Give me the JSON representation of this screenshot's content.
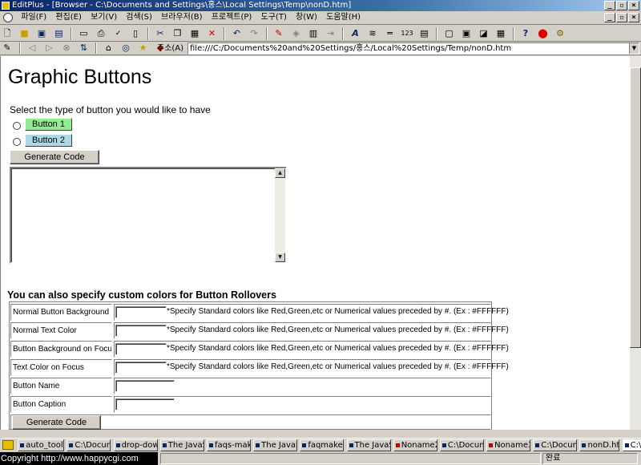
{
  "window": {
    "title": "EditPlus - [Browser - C:\\Documents and Settings\\홍스\\Local Settings\\Temp\\nonD.htm]"
  },
  "menu": {
    "items": [
      "파일(F)",
      "편집(E)",
      "보기(V)",
      "검색(S)",
      "브라우저(B)",
      "프로젝트(P)",
      "도구(T)",
      "창(W)",
      "도움말(H)"
    ]
  },
  "toolbar": {
    "buttons": [
      "new-file-icon",
      "open-folder-icon",
      "save-icon",
      "save-all-icon",
      "print-preview-icon",
      "print-icon",
      "spell-check-icon",
      "page-icon",
      "cut-icon",
      "copy-icon",
      "paste-icon",
      "delete-icon",
      "undo-icon",
      "redo-icon",
      "find-icon",
      "find-next-icon",
      "replace-icon",
      "goto-icon",
      "font-icon",
      "wordwrap-icon",
      "ruler-icon",
      "line-number-icon",
      "cliptext-icon",
      "window-icon",
      "tile-icon",
      "cascade-icon",
      "fullscreen-icon",
      "help-icon",
      "close-red-icon",
      "tools-icon"
    ]
  },
  "address": {
    "label": "주소(A)",
    "value": "file:///C:/Documents%20and%20Settings/홍스/Local%20Settings/Temp/nonD.htm"
  },
  "page": {
    "title": "Graphic Buttons",
    "instruction": "Select the type of button you would like to have",
    "button1_label": "Button 1",
    "button2_label": "Button 2",
    "generate_label": "Generate Code",
    "rollover_heading": "You can also specify custom colors for Button Rollovers",
    "hint": "*Specify Standard colors like Red,Green,etc or Numerical values preceded by #. (Ex : #FFFFFF)",
    "rows": [
      {
        "label": "Normal Button Background"
      },
      {
        "label": "Normal Text Color"
      },
      {
        "label": "Button Background on Focus"
      },
      {
        "label": "Text Color on Focus"
      },
      {
        "label": "Button Name"
      },
      {
        "label": "Button Caption"
      }
    ],
    "generate2_label": "Generate Code",
    "colors": {
      "button1": "#90ee90",
      "button2": "#add8e6"
    }
  },
  "taskbar": {
    "tabs": [
      "auto_tooltip",
      "C:\\Documents",
      "drop-down",
      "The JavaScript",
      "faqs-maker",
      "The JavaScript",
      "faqmaker.",
      "The JavaScript",
      "Noname2",
      "C:\\Documents",
      "Noname3",
      "C:\\Documents",
      "nonD.htm",
      "C:\\Documents"
    ]
  },
  "status": {
    "copyright": "Copyright   http://www.happycgi.com",
    "state": "완료"
  }
}
